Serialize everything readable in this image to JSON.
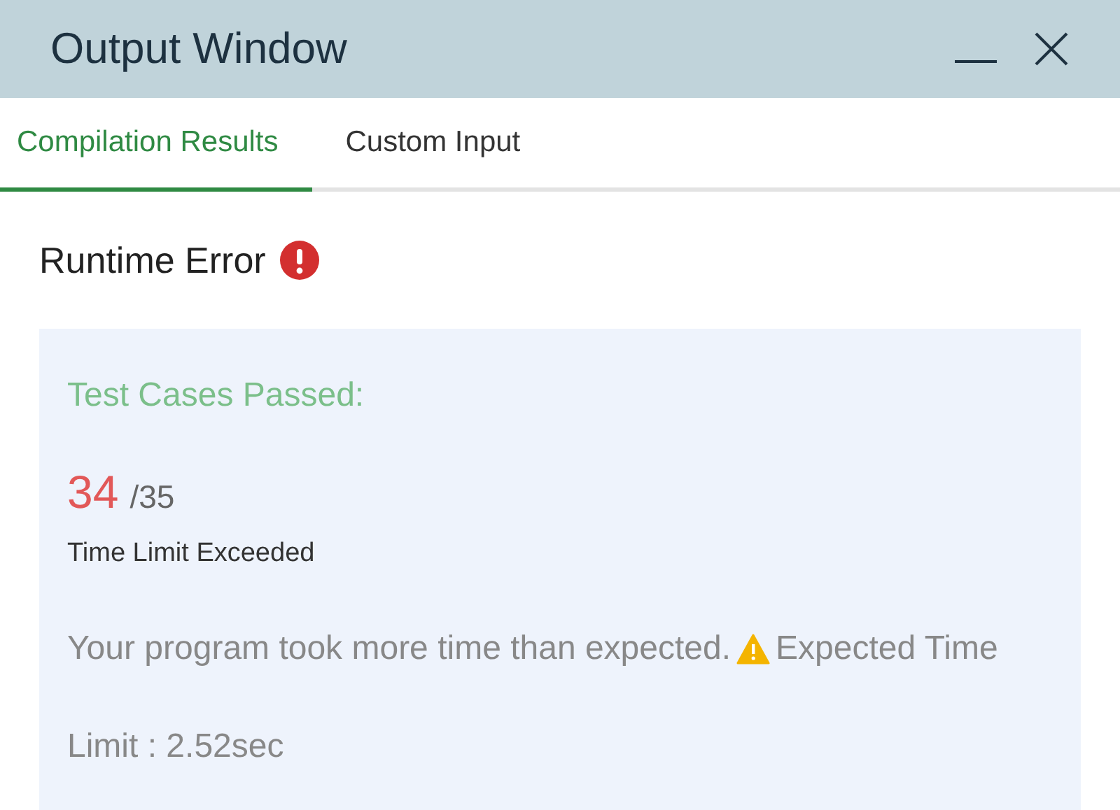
{
  "window": {
    "title": "Output Window"
  },
  "tabs": [
    {
      "label": "Compilation Results",
      "selected": true
    },
    {
      "label": "Custom Input",
      "selected": false
    }
  ],
  "result": {
    "heading": "Runtime Error",
    "error": true
  },
  "card": {
    "label": "Test Cases Passed:",
    "passed": "34",
    "total": "/35",
    "verdict": "Time Limit Exceeded",
    "message": [
      {
        "kind": "text",
        "text": "Your program took more time than expected."
      },
      {
        "kind": "warning"
      },
      {
        "kind": "text",
        "text": "Expected Time"
      },
      {
        "kind": "break"
      },
      {
        "kind": "text",
        "text": "Limit : 2.52sec"
      }
    ]
  }
}
